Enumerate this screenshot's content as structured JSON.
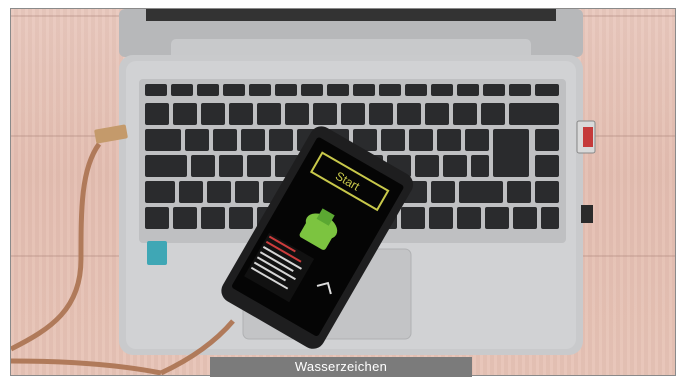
{
  "photo": {
    "phone_screen": {
      "start_label": "Start"
    }
  },
  "watermark": {
    "text": "Wasserzeichen"
  }
}
